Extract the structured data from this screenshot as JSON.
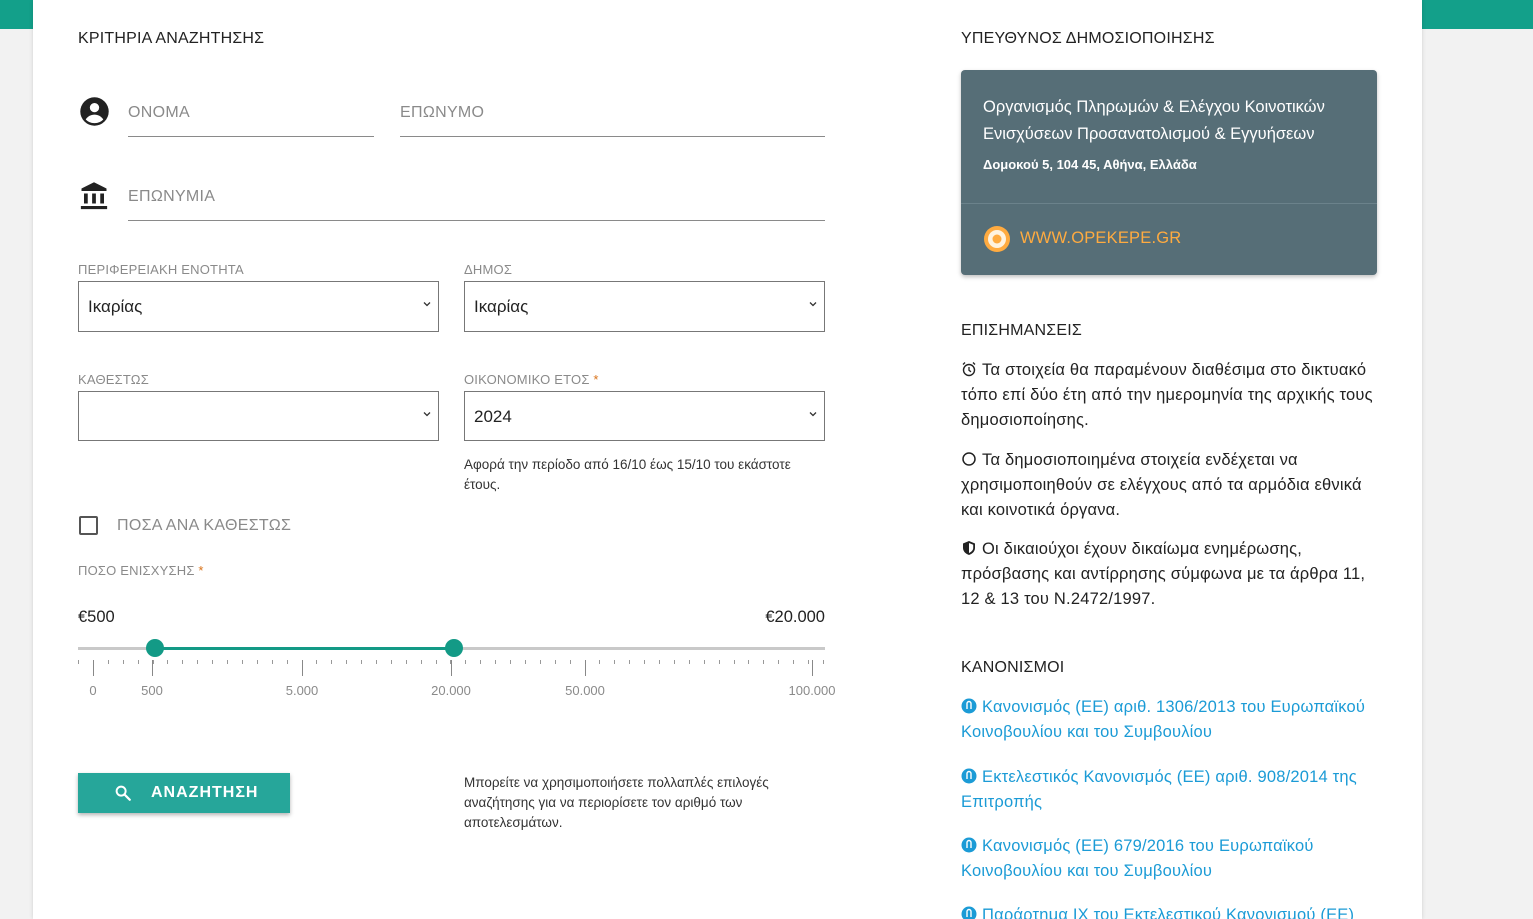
{
  "search": {
    "title": "ΚΡΙΤΗΡΙΑ ΑΝΑΖΗΤΗΣΗΣ",
    "first_name_placeholder": "ΟΝΟΜΑ",
    "last_name_placeholder": "ΕΠΩΝΥΜΟ",
    "company_placeholder": "ΕΠΩΝΥΜΙΑ",
    "region_label": "ΠΕΡΙΦΕΡΕΙΑΚΗ ΕΝΟΤΗΤΑ",
    "region_value": "Ικαρίας",
    "municipality_label": "ΔΗΜΟΣ",
    "municipality_value": "Ικαρίας",
    "status_label": "ΚΑΘΕΣΤΩΣ",
    "status_value": "",
    "fiscal_year_label": "ΟΙΚΟΝΟΜΙΚΟ ΕΤΟΣ",
    "required_mark": "*",
    "fiscal_year_value": "2024",
    "fiscal_year_help": "Αφορά την περίοδο από 16/10 έως 15/10 του εκάστοτε έτους.",
    "amounts_by_status_label": "ΠΟΣΑ ΑΝΑ ΚΑΘΕΣΤΩΣ",
    "amounts_by_status_checked": false,
    "amount_label": "ΠΟΣΟ ΕΝΙΣΧΥΣΗΣ",
    "amount_min": "€500",
    "amount_max": "€20.000",
    "slider_ticks": [
      "0",
      "500",
      "5.000",
      "20.000",
      "50.000",
      "100.000"
    ],
    "search_button": "ΑΝΑΖΗΤΗΣΗ",
    "search_help": "Μπορείτε να χρησιμοποιήσετε πολλαπλές επιλογές αναζήτησης για να περιορίσετε τον αριθμό των αποτελεσμάτων."
  },
  "publisher": {
    "title": "ΥΠΕΥΘΥΝΟΣ ΔΗΜΟΣΙΟΠΟΙΗΣΗΣ",
    "org": "Οργανισμός Πληρωμών & Ελέγχου Κοινοτικών Ενισχύσεων Προσανατολισμού & Εγγυήσεων",
    "address": "Δομοκού 5, 104 45, Αθήνα, Ελλάδα",
    "website": "WWW.OPEKEPE.GR"
  },
  "notes": {
    "title": "ΕΠΙΣΗΜΑΝΣΕΙΣ",
    "items": [
      "Τα στοιχεία θα παραμένουν διαθέσιμα στο δικτυακό τόπο επί δύο έτη από την ημερομηνία της αρχικής τους δημοσιοποίησης.",
      "Τα δημοσιοποιημένα στοιχεία ενδέχεται να χρησιμοποιηθούν σε ελέγχους από τα αρμόδια εθνικά και κοινοτικά όργανα.",
      "Οι δικαιούχοι έχουν δικαίωμα ενημέρωσης, πρόσβασης και αντίρρησης σύμφωνα με τα άρθρα 11, 12 & 13 του Ν.2472/1997."
    ]
  },
  "regulations": {
    "title": "ΚΑΝΟΝΙΣΜΟΙ",
    "items": [
      "Κανονισμός (ΕΕ) αριθ. 1306/2013 του Ευρωπαϊκού Κοινοβουλίου και του Συμβουλίου",
      "Εκτελεστικός Κανονισμός (ΕΕ) αριθ. 908/2014 της Επιτροπής",
      "Κανονισμός (ΕΕ) 679/2016 του Ευρωπαϊκού Κοινοβουλίου και του Συμβουλίου",
      "Παράρτημα IX του Εκτελεστικού Κανονισμού (ΕΕ)"
    ]
  },
  "colors": {
    "accent": "#139a86",
    "button": "#26a69a",
    "card": "#566e77",
    "link": "#1b9bd6",
    "website": "#ffab40"
  }
}
